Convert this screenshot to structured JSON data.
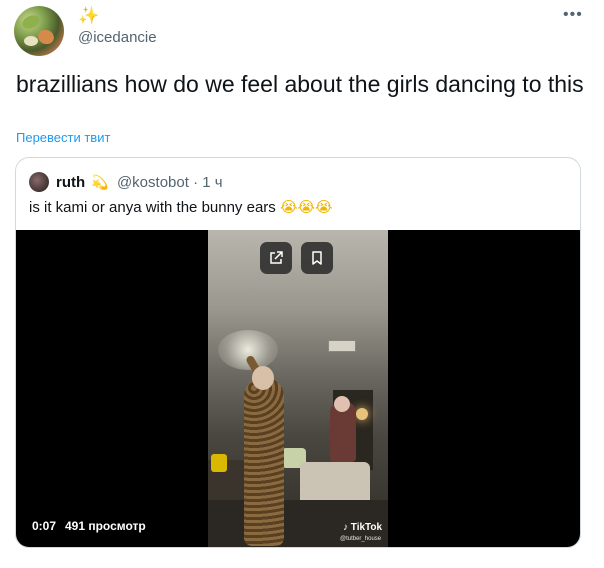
{
  "tweet": {
    "name_emoji": "✨",
    "handle": "@icedancie",
    "more_label": "•••",
    "text": "brazillians how do we feel about the girls dancing to this",
    "translate_label": "Перевести твит"
  },
  "quote": {
    "name": "ruth",
    "name_emoji": "💫",
    "handle": "@kostobot",
    "time": "· 1 ч",
    "text": "is it kami or anya with the bunny ears ",
    "emojis": "😭😭😭"
  },
  "video": {
    "time": "0:07",
    "views": "491 просмотр",
    "watermark": "TikTok",
    "watermark_handle": "@tutber_house",
    "buttons": [
      "external-link-icon",
      "bookmark-icon"
    ]
  }
}
